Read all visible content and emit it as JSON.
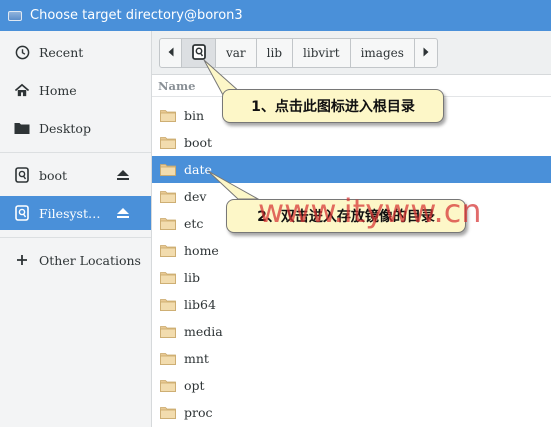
{
  "window": {
    "title": "Choose target directory@boron3"
  },
  "sidebar": {
    "items": [
      {
        "label": "Recent",
        "icon": "clock-icon"
      },
      {
        "label": "Home",
        "icon": "home-icon"
      },
      {
        "label": "Desktop",
        "icon": "folder-icon"
      },
      {
        "label": "boot",
        "icon": "drive-icon",
        "eject": true
      },
      {
        "label": "Filesyst…",
        "icon": "drive-icon",
        "eject": true,
        "selected": true
      },
      {
        "label": "Other Locations",
        "icon": "plus-icon"
      }
    ]
  },
  "pathbar": {
    "segments": [
      "var",
      "lib",
      "libvirt",
      "images"
    ]
  },
  "list": {
    "header": "Name",
    "items": [
      "bin",
      "boot",
      "date",
      "dev",
      "etc",
      "home",
      "lib",
      "lib64",
      "media",
      "mnt",
      "opt",
      "proc"
    ],
    "selected": "date"
  },
  "annotations": {
    "callout1": "1、点击此图标进入根目录",
    "callout2": "2、双击进入存放镜像的目录"
  },
  "watermark": "www.ityww.cn",
  "colors": {
    "accent": "#4a90d9",
    "callout_bg": "#fdf7c8",
    "folder": "#e8c994"
  }
}
